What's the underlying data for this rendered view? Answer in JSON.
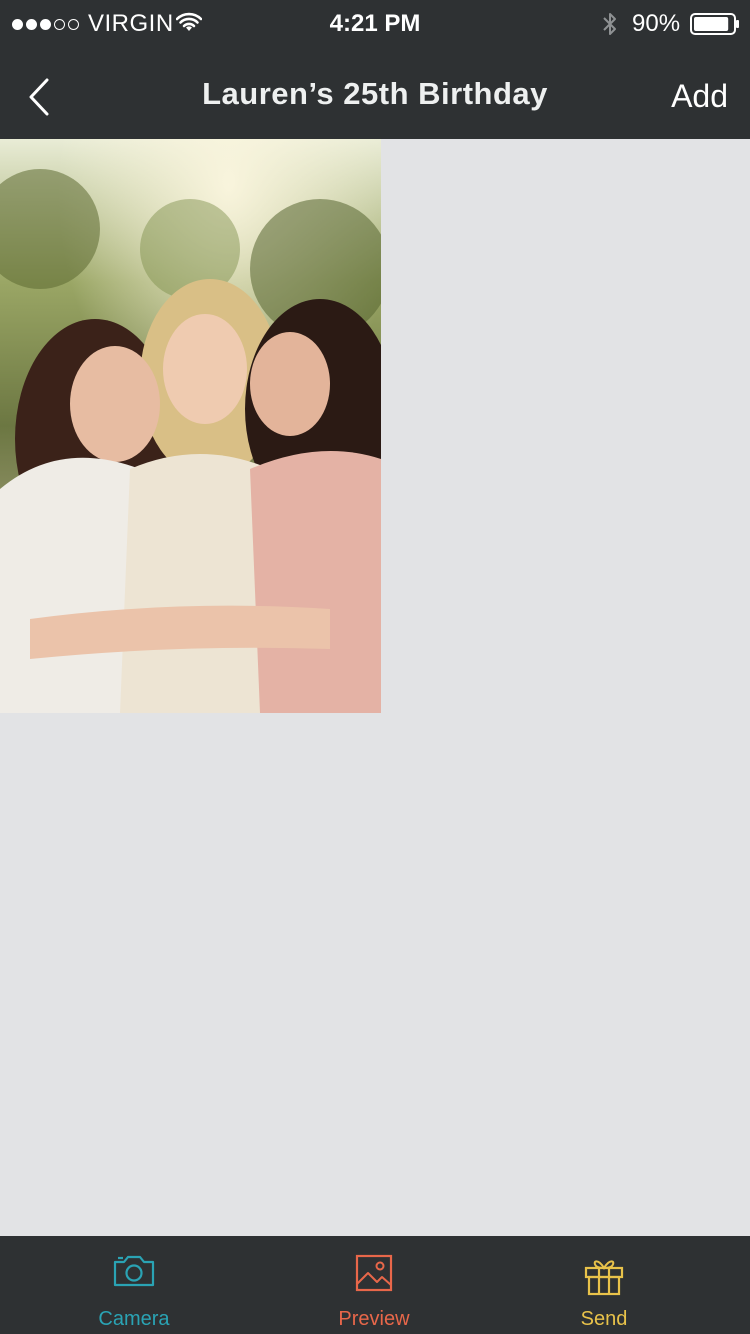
{
  "status_bar": {
    "carrier": "VIRGIN",
    "time": "4:21 PM",
    "battery": "90%",
    "signal_bars": 3,
    "signal_total": 5,
    "battery_level": 0.9
  },
  "nav": {
    "back_icon": "chevron-left-icon",
    "title": "Lauren’s 25th Birthday",
    "add_label": "Add"
  },
  "photos": [
    {
      "alt": "three friends hugging outdoors"
    }
  ],
  "tabs": [
    {
      "label": "Camera",
      "icon": "camera-icon",
      "color": "#2aa3b4"
    },
    {
      "label": "Preview",
      "icon": "image-icon",
      "color": "#e8674a"
    },
    {
      "label": "Send",
      "icon": "gift-icon",
      "color": "#e8c24a"
    }
  ],
  "colors": {
    "bar_background": "#2e3133",
    "content_background": "#e2e3e5"
  }
}
